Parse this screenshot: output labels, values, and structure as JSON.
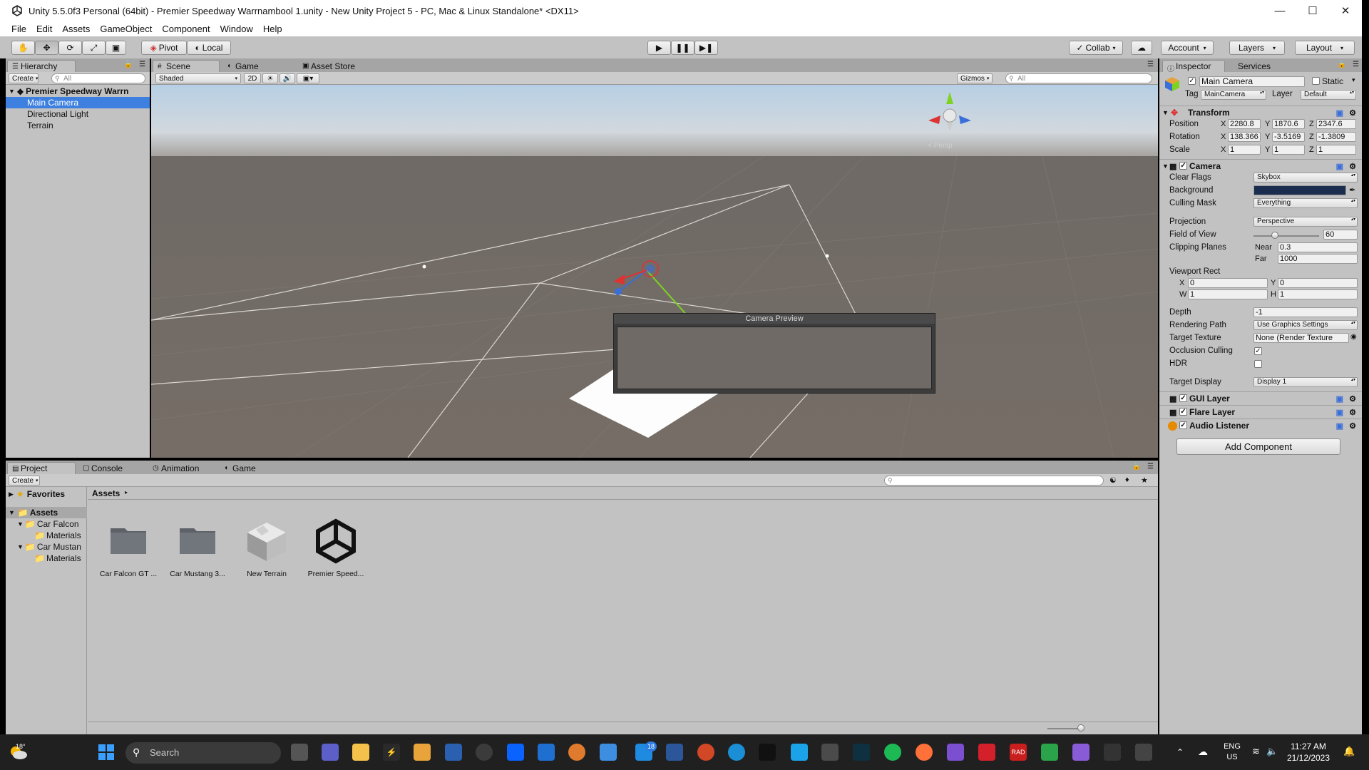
{
  "window": {
    "title": "Unity 5.5.0f3 Personal (64bit) - Premier Speedway Warrnambool 1.unity - New Unity Project 5 - PC, Mac & Linux Standalone* <DX11>",
    "minimize_icon": "minimize-icon",
    "maximize_icon": "maximize-icon",
    "close_icon": "close-icon"
  },
  "menu": [
    "File",
    "Edit",
    "Assets",
    "GameObject",
    "Component",
    "Window",
    "Help"
  ],
  "toolbar": {
    "pivot": "Pivot",
    "local": "Local",
    "collab": "Collab",
    "account": "Account",
    "layers": "Layers",
    "layout": "Layout"
  },
  "hierarchy": {
    "tab": "Hierarchy",
    "create": "Create",
    "search_placeholder": "All",
    "scene_name": "Premier Speedway Warrn",
    "items": [
      "Main Camera",
      "Directional Light",
      "Terrain"
    ],
    "selected": "Main Camera"
  },
  "scene": {
    "tabs": [
      "Scene",
      "Game",
      "Asset Store"
    ],
    "shading": "Shaded",
    "mode_2d": "2D",
    "gizmos": "Gizmos",
    "search_placeholder": "All",
    "persp_label": "< Persp",
    "camera_preview_title": "Camera Preview"
  },
  "inspector": {
    "tabs": [
      "Inspector",
      "Services"
    ],
    "object_name": "Main Camera",
    "static_label": "Static",
    "tag_label": "Tag",
    "tag_value": "MainCamera",
    "layer_label": "Layer",
    "layer_value": "Default",
    "transform": {
      "title": "Transform",
      "position_label": "Position",
      "rotation_label": "Rotation",
      "scale_label": "Scale",
      "position": {
        "x": "2280.8",
        "y": "1870.6",
        "z": "2347.6"
      },
      "rotation": {
        "x": "138.366",
        "y": "-3.5169",
        "z": "-1.3809"
      },
      "scale": {
        "x": "1",
        "y": "1",
        "z": "1"
      }
    },
    "camera": {
      "title": "Camera",
      "clear_flags_label": "Clear Flags",
      "clear_flags": "Skybox",
      "background_label": "Background",
      "background_color": "#1b2d4f",
      "culling_mask_label": "Culling Mask",
      "culling_mask": "Everything",
      "projection_label": "Projection",
      "projection": "Perspective",
      "fov_label": "Field of View",
      "fov": "60",
      "fov_slider_value": 60,
      "clipping_label": "Clipping Planes",
      "near_label": "Near",
      "near": "0.3",
      "far_label": "Far",
      "far": "1000",
      "viewport_label": "Viewport Rect",
      "vp_x": "0",
      "vp_y": "0",
      "vp_w": "1",
      "vp_h": "1",
      "depth_label": "Depth",
      "depth": "-1",
      "rendering_path_label": "Rendering Path",
      "rendering_path": "Use Graphics Settings",
      "target_texture_label": "Target Texture",
      "target_texture": "None (Render Texture",
      "occlusion_label": "Occlusion Culling",
      "occlusion": true,
      "hdr_label": "HDR",
      "hdr": false,
      "target_display_label": "Target Display",
      "target_display": "Display 1"
    },
    "components": [
      "GUI Layer",
      "Flare Layer",
      "Audio Listener"
    ],
    "add_component": "Add Component"
  },
  "project": {
    "tabs": [
      "Project",
      "Console",
      "Animation",
      "Game"
    ],
    "create": "Create",
    "favorites": "Favorites",
    "breadcrumb": "Assets",
    "tree": [
      {
        "label": "Assets",
        "level": 0
      },
      {
        "label": "Car Falcon",
        "level": 1
      },
      {
        "label": "Materials",
        "level": 2
      },
      {
        "label": "Car Mustan",
        "level": 1
      },
      {
        "label": "Materials",
        "level": 2
      }
    ],
    "assets": [
      {
        "label": "Car Falcon GT ...",
        "icon": "folder-icon"
      },
      {
        "label": "Car Mustang 3...",
        "icon": "folder-icon"
      },
      {
        "label": "New Terrain",
        "icon": "terrain-icon"
      },
      {
        "label": "Premier Speed...",
        "icon": "unity-scene-icon"
      }
    ]
  },
  "taskbar": {
    "weather": "18°",
    "search_placeholder": "Search",
    "notification_badge": "18",
    "lang": "ENG",
    "region": "US",
    "time": "11:27 AM",
    "date": "21/12/2023"
  }
}
